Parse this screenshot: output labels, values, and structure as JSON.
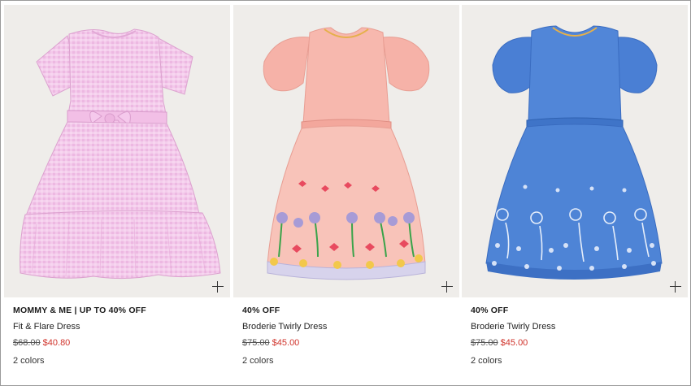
{
  "products": [
    {
      "promo": "MOMMY & ME | UP TO 40% OFF",
      "name": "Fit & Flare Dress",
      "was_price": "$68.00",
      "now_price": "$40.80",
      "colors": "2 colors",
      "image_alt": "Pink gingham seersucker dress with bow"
    },
    {
      "promo": "40% OFF",
      "name": "Broderie Twirly Dress",
      "was_price": "$75.00",
      "now_price": "$45.00",
      "colors": "2 colors",
      "image_alt": "Pink twirly dress with embroidered flowers"
    },
    {
      "promo": "40% OFF",
      "name": "Broderie Twirly Dress",
      "was_price": "$75.00",
      "now_price": "$45.00",
      "colors": "2 colors",
      "image_alt": "Blue twirly dress with broderie flowers"
    }
  ],
  "icons": {
    "quick_add": "plus-icon"
  },
  "colors": {
    "sale_red": "#d0342c",
    "image_bg": "#efedea"
  }
}
